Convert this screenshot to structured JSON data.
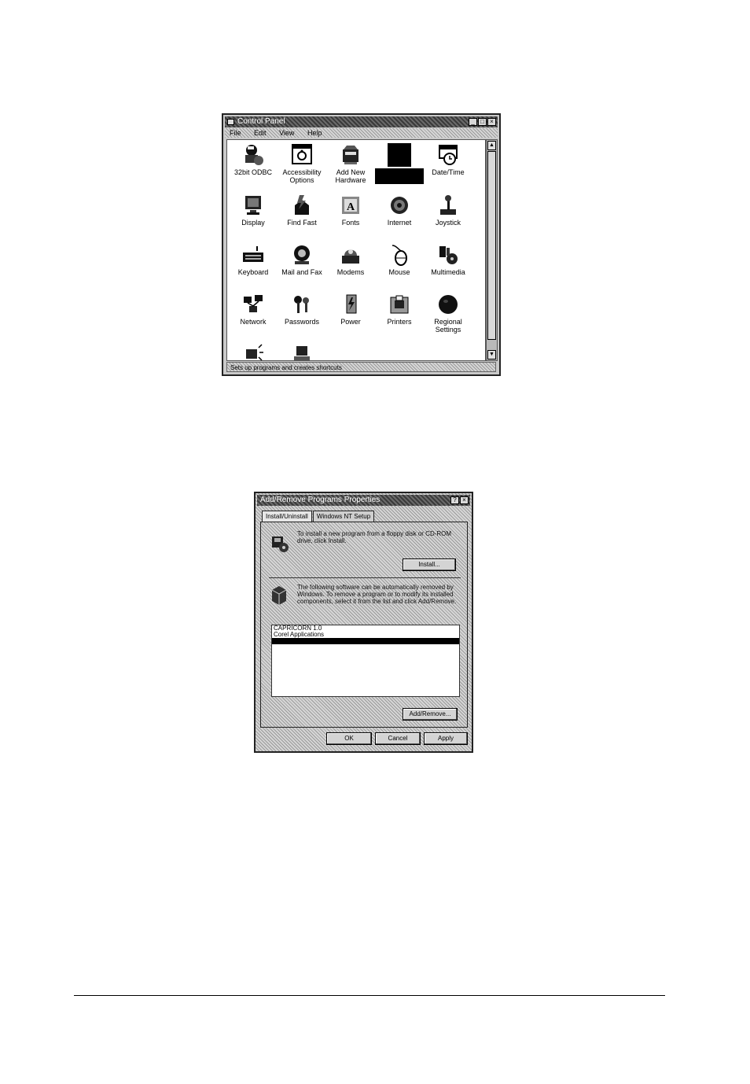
{
  "control_panel": {
    "title": "Control Panel",
    "menu": [
      "File",
      "Edit",
      "View",
      "Help"
    ],
    "window_buttons": [
      "_",
      "□",
      "×"
    ],
    "status_text": "Sets up programs and creates shortcuts",
    "items": [
      {
        "label": "32bit ODBC",
        "icon": "odbc-icon"
      },
      {
        "label": "Accessibility Options",
        "icon": "accessibility-icon"
      },
      {
        "label": "Add New Hardware",
        "icon": "add-hardware-icon"
      },
      {
        "label": "",
        "icon": "add-remove-programs-icon",
        "selected": true
      },
      {
        "label": "Date/Time",
        "icon": "date-time-icon"
      },
      {
        "label": "Display",
        "icon": "display-icon"
      },
      {
        "label": "Find Fast",
        "icon": "find-fast-icon"
      },
      {
        "label": "Fonts",
        "icon": "fonts-icon"
      },
      {
        "label": "Internet",
        "icon": "internet-icon"
      },
      {
        "label": "Joystick",
        "icon": "joystick-icon"
      },
      {
        "label": "Keyboard",
        "icon": "keyboard-icon"
      },
      {
        "label": "Mail and Fax",
        "icon": "mail-fax-icon"
      },
      {
        "label": "Modems",
        "icon": "modem-icon"
      },
      {
        "label": "Mouse",
        "icon": "mouse-icon"
      },
      {
        "label": "Multimedia",
        "icon": "multimedia-icon"
      },
      {
        "label": "Network",
        "icon": "network-icon"
      },
      {
        "label": "Passwords",
        "icon": "passwords-icon"
      },
      {
        "label": "Power",
        "icon": "power-icon"
      },
      {
        "label": "Printers",
        "icon": "printers-icon"
      },
      {
        "label": "Regional Settings",
        "icon": "regional-settings-icon"
      },
      {
        "label": "",
        "icon": "sounds-icon"
      },
      {
        "label": "",
        "icon": "system-icon"
      }
    ]
  },
  "add_remove": {
    "title": "Add/Remove Programs Properties",
    "window_buttons": [
      "?",
      "×"
    ],
    "tabs": [
      "Install/Uninstall",
      "Windows NT Setup"
    ],
    "install_text": "To install a new program from a floppy disk or CD-ROM drive, click Install.",
    "install_button": "Install...",
    "remove_text": "The following software can be automatically removed by Windows. To remove a program or to modify its installed components, select it from the list and click Add/Remove.",
    "programs": [
      "CAPRICORN 1.0",
      "Corel Applications",
      ""
    ],
    "add_remove_button": "Add/Remove...",
    "ok_button": "OK",
    "cancel_button": "Cancel",
    "apply_button": "Apply"
  }
}
